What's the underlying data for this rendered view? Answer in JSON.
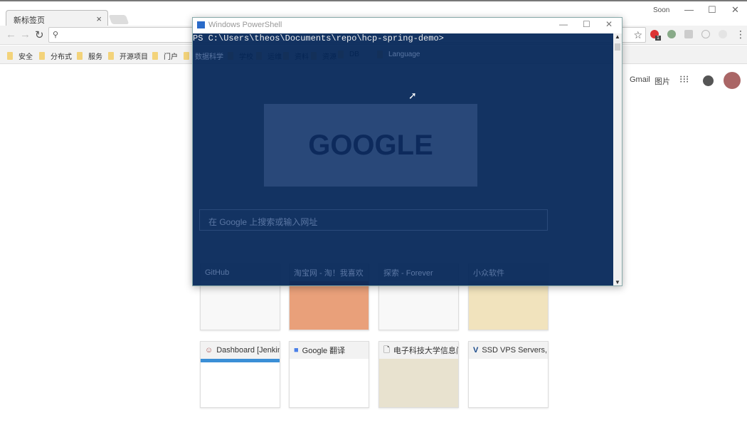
{
  "browser": {
    "tab_title": "新标签页",
    "user": "Soon",
    "bookmarks": [
      "安全",
      "分布式",
      "服务",
      "开源项目",
      "门户",
      "数据科学",
      "学校",
      "运维",
      "资料",
      "资源",
      "DB",
      "Language"
    ],
    "header_links": {
      "gmail": "Gmail",
      "images": "图片"
    },
    "doodle": "GOOGLE",
    "search_placeholder": "在 Google 上搜索或输入网址",
    "tiles_top": [
      "GitHub",
      "淘宝网 - 淘！我喜欢",
      "探索 - Forever",
      "小众软件"
    ],
    "tiles_bottom": [
      "Dashboard [Jenkins]",
      "Google 翻译",
      "电子科技大学信息门户",
      "SSD VPS Servers, Cloud"
    ],
    "extension_badge": "1"
  },
  "powershell": {
    "title": "Windows PowerShell",
    "prompt": "PS C:\\Users\\theos\\Documents\\repo\\hcp-spring-demo>"
  }
}
